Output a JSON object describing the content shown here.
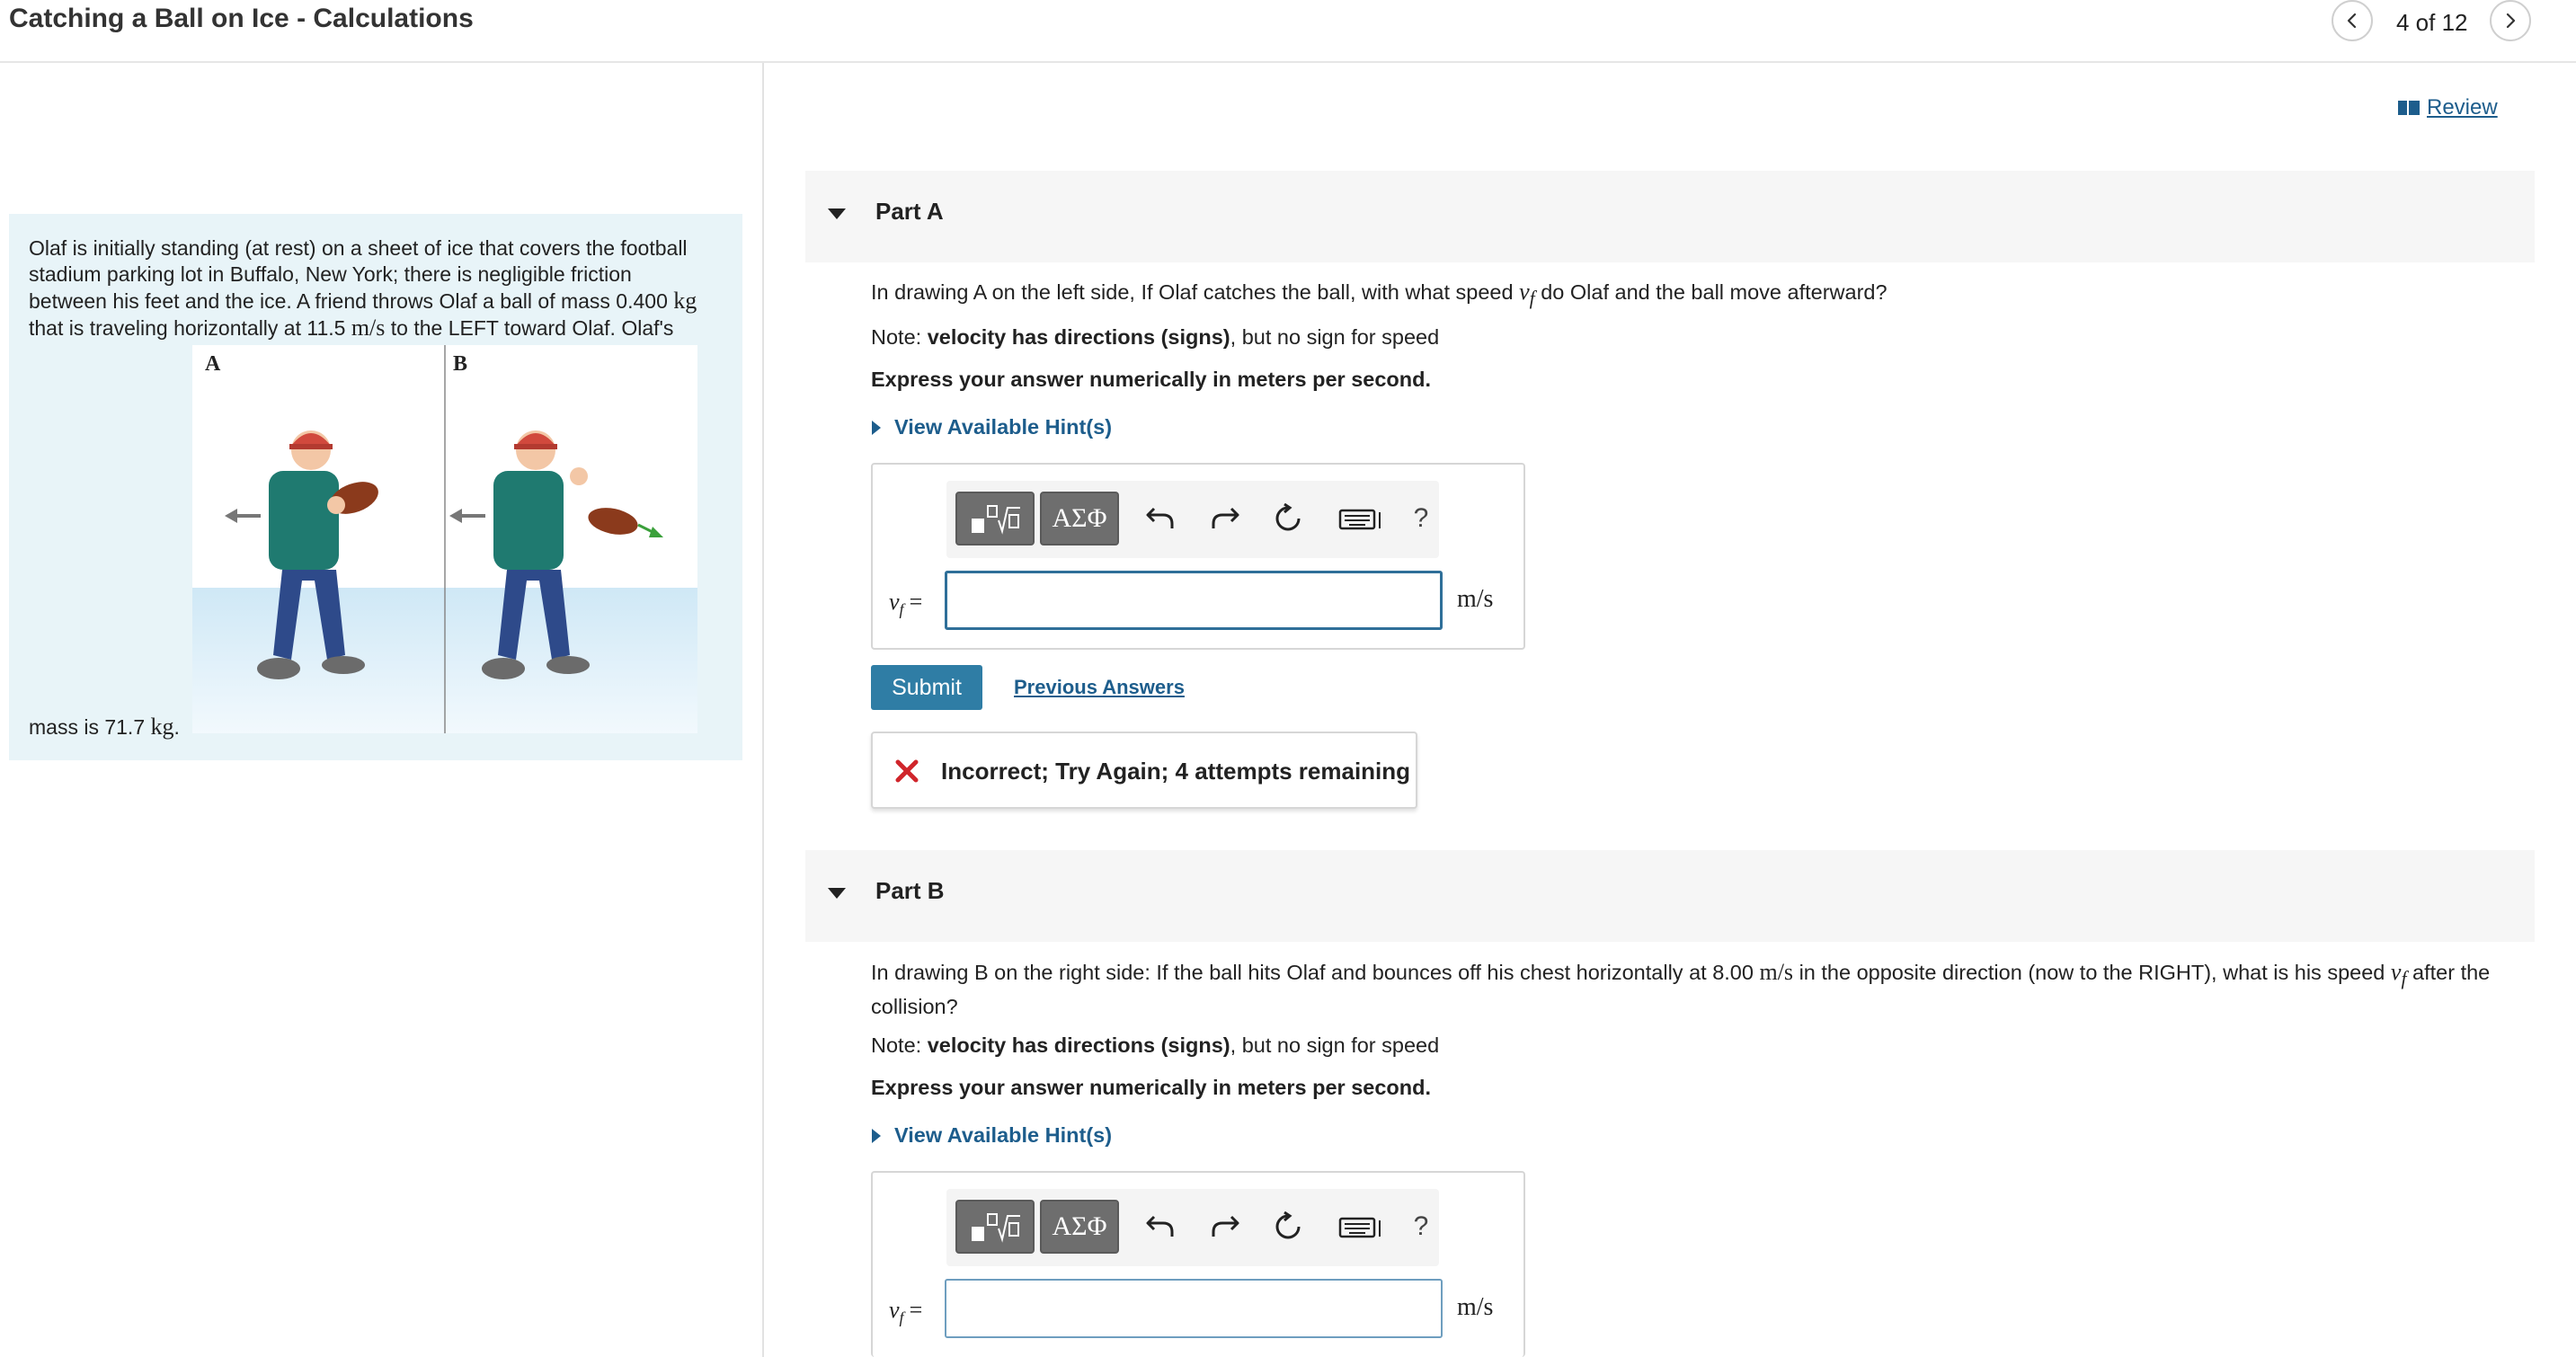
{
  "header": {
    "title": "Catching a Ball on Ice - Calculations",
    "page_position": "4 of 12",
    "prev_icon": "chevron-left-icon",
    "next_icon": "chevron-right-icon"
  },
  "review": {
    "label": "Review",
    "icon": "book-icon"
  },
  "problem": {
    "line1": "Olaf is initially standing (at rest) on a sheet of ice that covers the football",
    "line2": "stadium parking lot in Buffalo, New York; there is negligible friction",
    "line3_pre": "between his feet and the ice. A friend throws Olaf a ball of mass 0.400 ",
    "line3_unit": "kg",
    "line4_pre": "that is traveling horizontally at 11.5 ",
    "line4_unit": "m/s",
    "line4_post": " to the LEFT toward Olaf. Olaf's",
    "mass_pre": "mass is 71.7 ",
    "mass_unit": "kg",
    "mass_post": ".",
    "figure": {
      "label_a": "A",
      "label_b": "B"
    }
  },
  "part_a": {
    "label": "Part A",
    "question_pre": "In drawing A on the left side, If Olaf catches the ball, with what speed ",
    "question_var": "v",
    "question_sub": "f",
    "question_post": " do Olaf and the ball move afterward?",
    "note_pre": "Note: ",
    "note_bold": "velocity has directions (signs)",
    "note_post": ", but no sign for speed",
    "express": "Express your answer numerically in meters per second.",
    "hints": "View Available Hint(s)",
    "var": "v",
    "var_sub": "f",
    "eq": "=",
    "answer_value": "",
    "unit": "m/s",
    "submit": "Submit",
    "previous_answers": "Previous Answers",
    "feedback": "Incorrect; Try Again; 4 attempts remaining"
  },
  "part_b": {
    "label": "Part B",
    "question_pre": "In drawing B on the right side: If the ball hits Olaf and bounces off his chest horizontally at 8.00 ",
    "question_unit": "m/s",
    "question_mid": " in the opposite direction (now to the RIGHT), what is his speed ",
    "question_var": "v",
    "question_sub": "f",
    "question_post": " after the",
    "question_line2": "collision?",
    "note_pre": "Note: ",
    "note_bold": "velocity has directions (signs)",
    "note_post": ", but no sign for speed",
    "express": "Express your answer numerically in meters per second.",
    "hints": "View Available Hint(s)",
    "var": "v",
    "var_sub": "f",
    "eq": "=",
    "answer_value": "",
    "unit": "m/s"
  },
  "toolbar": {
    "greek": "ΑΣΦ",
    "help": "?",
    "icons": [
      "templates-icon",
      "undo-icon",
      "redo-icon",
      "reset-icon",
      "keyboard-icon"
    ]
  },
  "colors": {
    "link": "#1d5d8c",
    "submit": "#2f7da5",
    "problem_bg": "#e8f4f8",
    "error": "#d0252b"
  }
}
